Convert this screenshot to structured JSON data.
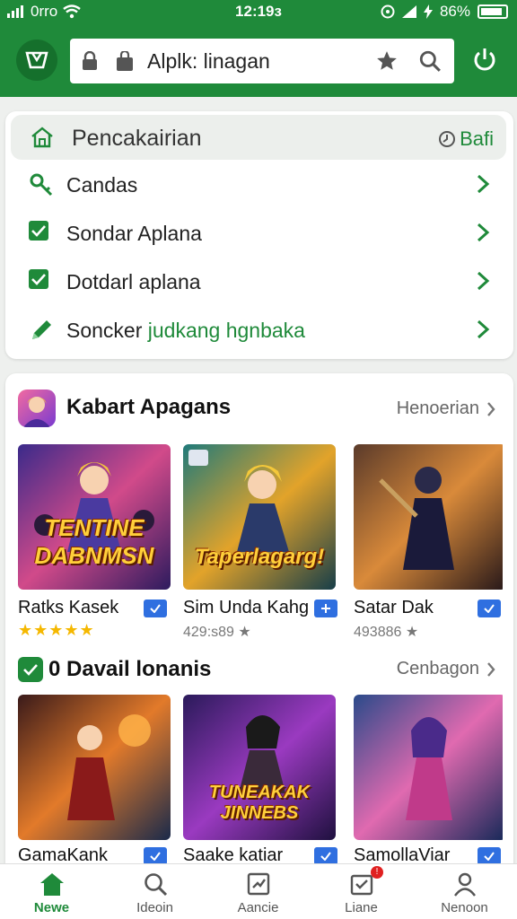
{
  "status": {
    "carrier": "0rro",
    "time": "12:19з",
    "battery": "86%"
  },
  "header": {
    "url": "Alplk: linagan"
  },
  "menu": {
    "header_title": "Pencakairian",
    "header_action": "Bafi",
    "items": [
      {
        "label": "Candas",
        "icon": "key-icon"
      },
      {
        "label": "Sondar Aplana",
        "icon": "checkbox-icon"
      },
      {
        "label": "Dotdarl aplana",
        "icon": "checkbox-icon"
      },
      {
        "label_main": "Soncker ",
        "label_highlight": "judkang hgnbaka",
        "icon": "pencil-icon"
      }
    ]
  },
  "sections": [
    {
      "title": "Kabart Apagans",
      "link": "Henoerian",
      "apps": [
        {
          "name": "Ratks Kasek",
          "rating": "★★★★★",
          "poster_text": "TENTINE DABNMSN",
          "colors": [
            "#3a2a8a",
            "#d14a8a",
            "#2d1b5e"
          ]
        },
        {
          "name": "Sim Unda Kahg",
          "meta": "429:s89 ★",
          "poster_text": "Taperlagarg!",
          "colors": [
            "#1f7a7a",
            "#e2a32a",
            "#0f3a4a"
          ]
        },
        {
          "name": "Satar Dak",
          "meta": "493886 ★",
          "poster_text": "",
          "colors": [
            "#5a3a2a",
            "#d98a3a",
            "#2a1a1a"
          ]
        }
      ]
    },
    {
      "title": "0 Davail lonanis",
      "link": "Cenbagon",
      "apps": [
        {
          "name": "GamaKank",
          "poster_text": "",
          "colors": [
            "#3a1a1a",
            "#e27a2a",
            "#1a2a4a"
          ]
        },
        {
          "name": "Saake katiar",
          "poster_text": "TUNEAKAK JINNEBS",
          "colors": [
            "#2a1a5a",
            "#9a3ac0",
            "#1a0f3a"
          ]
        },
        {
          "name": "SamollaViar",
          "poster_text": "",
          "colors": [
            "#2a4a8a",
            "#e06ab0",
            "#1a2a5a"
          ]
        }
      ]
    }
  ],
  "bottom_nav": [
    {
      "label": "Newe",
      "icon": "home-icon",
      "active": true
    },
    {
      "label": "Ideoin",
      "icon": "search-icon"
    },
    {
      "label": "Aancie",
      "icon": "chart-icon"
    },
    {
      "label": "Liane",
      "icon": "inbox-icon",
      "badge": "!"
    },
    {
      "label": "Nenoon",
      "icon": "profile-icon"
    }
  ],
  "colors": {
    "primary": "#1f8a3a",
    "star": "#f5b800",
    "badge": "#2f6fe0"
  }
}
